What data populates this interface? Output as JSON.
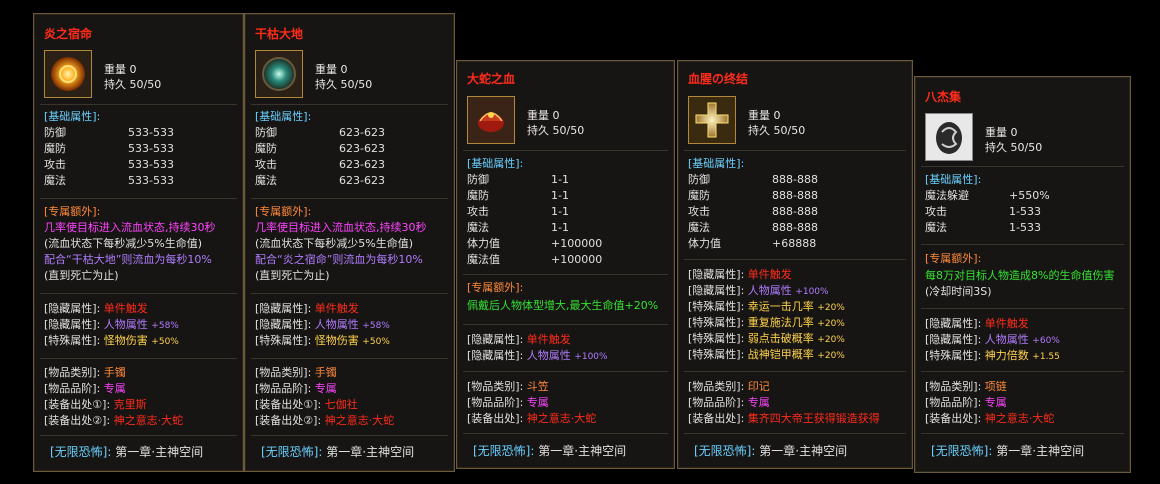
{
  "colors": {
    "title": "#ff2b1b",
    "section": "#6ad0ff",
    "extra": "#ff8a3a",
    "border": "#6b5a3a"
  },
  "cards": [
    {
      "title": "炎之宿命",
      "icon": "fire-orb-icon",
      "weight": "重量 0",
      "durability": "持久 50/50",
      "base_header": "[基础属性]:",
      "base": [
        [
          "防御",
          "533-533"
        ],
        [
          "魔防",
          "533-533"
        ],
        [
          "攻击",
          "533-533"
        ],
        [
          "魔法",
          "533-533"
        ]
      ],
      "extra_header": "[专属额外]:",
      "extra": [
        "几率使目标进入流血状态,持续30秒",
        "(流血状态下每秒减少5%生命值)",
        "配合“干枯大地”则流血为每秒10%",
        "(直到死亡为止)"
      ],
      "hidden": [
        [
          "[隐藏属性]:",
          "单件触发",
          ""
        ],
        [
          "[隐藏属性]:",
          "人物属性",
          "+58%"
        ],
        [
          "[特殊属性]:",
          "怪物伤害",
          "+50%"
        ]
      ],
      "info": [
        [
          "[物品类别]:",
          "手镯"
        ],
        [
          "[物品品阶]:",
          "专属"
        ],
        [
          "[装备出处①]:",
          "克里斯"
        ],
        [
          "[装备出处②]:",
          "神之意志·大蛇"
        ]
      ],
      "footer": [
        "[无限恐怖]:",
        "第一章·主神空间"
      ]
    },
    {
      "title": "干枯大地",
      "icon": "earth-orb-icon",
      "weight": "重量 0",
      "durability": "持久 50/50",
      "base_header": "[基础属性]:",
      "base": [
        [
          "防御",
          "623-623"
        ],
        [
          "魔防",
          "623-623"
        ],
        [
          "攻击",
          "623-623"
        ],
        [
          "魔法",
          "623-623"
        ]
      ],
      "extra_header": "[专属额外]:",
      "extra": [
        "几率使目标进入流血状态,持续30秒",
        "(流血状态下每秒减少5%生命值)",
        "配合“炎之宿命”则流血为每秒10%",
        "(直到死亡为止)"
      ],
      "hidden": [
        [
          "[隐藏属性]:",
          "单件触发",
          ""
        ],
        [
          "[隐藏属性]:",
          "人物属性",
          "+58%"
        ],
        [
          "[特殊属性]:",
          "怪物伤害",
          "+50%"
        ]
      ],
      "info": [
        [
          "[物品类别]:",
          "手镯"
        ],
        [
          "[物品品阶]:",
          "专属"
        ],
        [
          "[装备出处①]:",
          "七伽社"
        ],
        [
          "[装备出处②]:",
          "神之意志·大蛇"
        ]
      ],
      "footer": [
        "[无限恐怖]:",
        "第一章·主神空间"
      ]
    },
    {
      "title": "大蛇之血",
      "icon": "blood-helmet-icon",
      "weight": "重量 0",
      "durability": "持久 50/50",
      "base_header": "[基础属性]:",
      "base": [
        [
          "防御",
          "1-1"
        ],
        [
          "魔防",
          "1-1"
        ],
        [
          "攻击",
          "1-1"
        ],
        [
          "魔法",
          "1-1"
        ],
        [
          "体力值",
          "+100000"
        ],
        [
          "魔法值",
          "+100000"
        ]
      ],
      "extra_header": "[专属额外]:",
      "extra": [
        "佩戴后人物体型增大,最大生命值+20%"
      ],
      "hidden": [
        [
          "[隐藏属性]:",
          "单件触发",
          ""
        ],
        [
          "[隐藏属性]:",
          "人物属性",
          "+100%"
        ]
      ],
      "info": [
        [
          "[物品类别]:",
          "斗笠"
        ],
        [
          "[物品品阶]:",
          "专属"
        ],
        [
          "[装备出处]:",
          "神之意志·大蛇"
        ]
      ],
      "footer": [
        "[无限恐怖]:",
        "第一章·主神空间"
      ]
    },
    {
      "title": "血腥の终结",
      "icon": "golden-cross-icon",
      "weight": "重量 0",
      "durability": "持久 50/50",
      "base_header": "[基础属性]:",
      "base": [
        [
          "防御",
          "888-888"
        ],
        [
          "魔防",
          "888-888"
        ],
        [
          "攻击",
          "888-888"
        ],
        [
          "魔法",
          "888-888"
        ],
        [
          "体力值",
          "+68888"
        ]
      ],
      "hidden": [
        [
          "[隐藏属性]:",
          "单件触发",
          ""
        ],
        [
          "[隐藏属性]:",
          "人物属性",
          "+100%"
        ],
        [
          "[特殊属性]:",
          "幸运一击几率",
          "+20%"
        ],
        [
          "[特殊属性]:",
          "重复施法几率",
          "+20%"
        ],
        [
          "[特殊属性]:",
          "弱点击破概率",
          "+20%"
        ],
        [
          "[特殊属性]:",
          "战神铠甲概率",
          "+20%"
        ]
      ],
      "info": [
        [
          "[物品类别]:",
          "印记"
        ],
        [
          "[物品品阶]:",
          "专属"
        ],
        [
          "[装备出处]:",
          "集齐四大帝王获得锻造获得"
        ]
      ],
      "footer": [
        "[无限恐怖]:",
        "第一章·主神空间"
      ]
    },
    {
      "title": "八杰集",
      "icon": "dragon-stone-icon",
      "weight": "重量 0",
      "durability": "持久 50/50",
      "base_header": "[基础属性]:",
      "base": [
        [
          "魔法躲避",
          "+550%"
        ],
        [
          "攻击",
          "1-533"
        ],
        [
          "魔法",
          "1-533"
        ]
      ],
      "extra_header": "[专属额外]:",
      "extra": [
        "每8万对目标人物造成8%的生命值伤害",
        "(冷却时间3S)"
      ],
      "hidden": [
        [
          "[隐藏属性]:",
          "单件触发",
          ""
        ],
        [
          "[隐藏属性]:",
          "人物属性",
          "+60%"
        ],
        [
          "[特殊属性]:",
          "神力倍数",
          "+1.55"
        ]
      ],
      "info": [
        [
          "[物品类别]:",
          "项链"
        ],
        [
          "[物品品阶]:",
          "专属"
        ],
        [
          "[装备出处]:",
          "神之意志·大蛇"
        ]
      ],
      "footer": [
        "[无限恐怖]:",
        "第一章·主神空间"
      ]
    }
  ]
}
